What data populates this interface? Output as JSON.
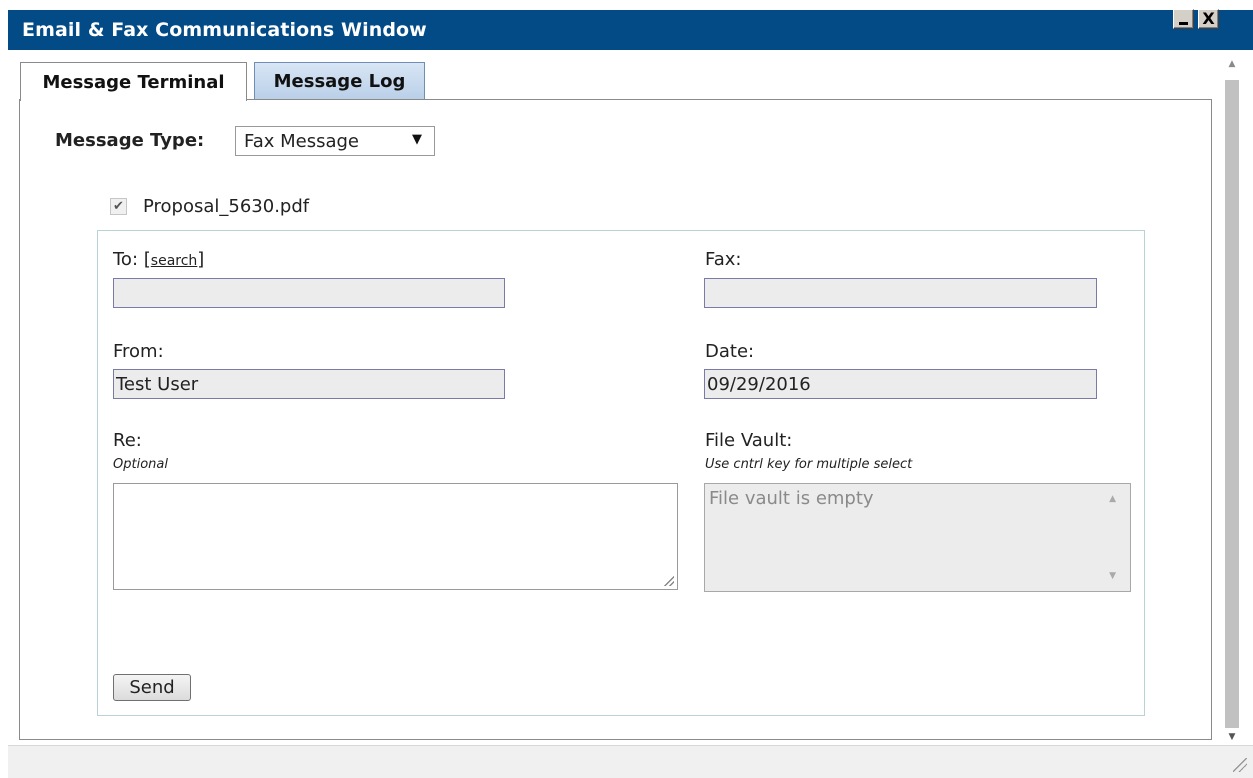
{
  "window": {
    "title": "Email & Fax Communications Window",
    "minimize_icon": "minimize-icon",
    "close_icon": "close-icon",
    "close_glyph": "X"
  },
  "tabs": [
    {
      "label": "Message Terminal",
      "active": true
    },
    {
      "label": "Message Log",
      "active": false
    }
  ],
  "message_type": {
    "label": "Message Type:",
    "selected": "Fax Message",
    "arrow": "▼"
  },
  "attachment": {
    "checked": true,
    "check_glyph": "✔",
    "filename": "Proposal_5630.pdf"
  },
  "form": {
    "to_label": "To:",
    "search_link": "search",
    "bracket_open": "[",
    "bracket_close": "]",
    "to_value": "",
    "fax_label": "Fax:",
    "fax_value": "",
    "from_label": "From:",
    "from_value": "Test User",
    "date_label": "Date:",
    "date_value": "09/29/2016",
    "re_label": "Re:",
    "re_hint": "Optional",
    "re_value": "",
    "vault_label": "File Vault:",
    "vault_hint": "Use cntrl key for multiple select",
    "vault_empty": "File vault is empty",
    "send_label": "Send"
  },
  "scrollbar": {
    "up_arrow": "▲",
    "down_arrow": "▼"
  },
  "colors": {
    "titlebar": "#034b86",
    "tab_inactive": "#c8dbef"
  }
}
